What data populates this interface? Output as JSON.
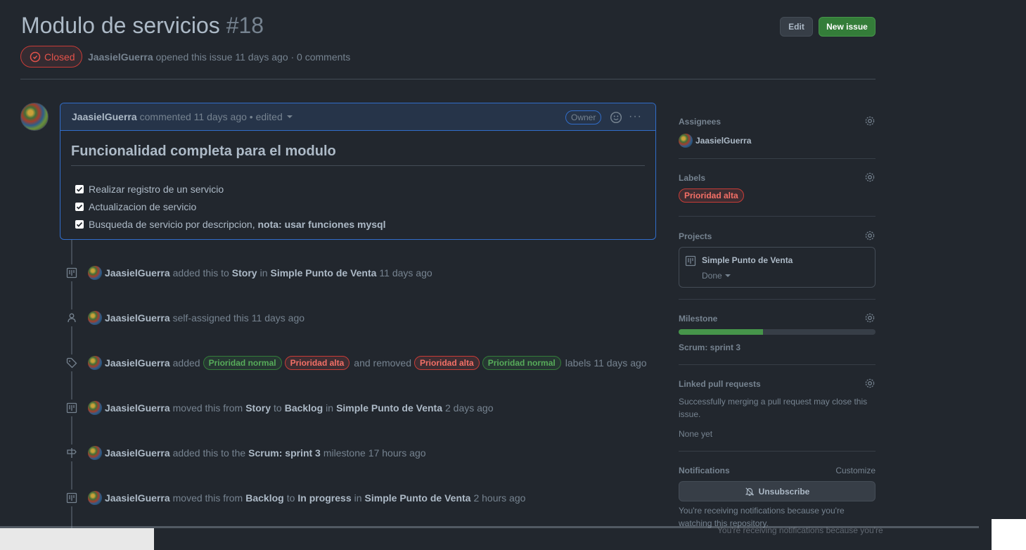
{
  "issue": {
    "title": "Modulo de servicios",
    "number": "#18",
    "state": "Closed",
    "author": "JaasielGuerra",
    "meta_text": "opened this issue 11 days ago · 0 comments",
    "edit_label": "Edit",
    "new_issue_label": "New issue"
  },
  "comment": {
    "author": "JaasielGuerra",
    "meta": "commented 11 days ago • edited",
    "badge": "Owner",
    "heading": "Funcionalidad completa para el modulo",
    "tasks": [
      {
        "text": "Realizar registro de un servicio",
        "strong": ""
      },
      {
        "text": "Actualizacion de servicio",
        "strong": ""
      },
      {
        "text": "Busqueda de servicio por descripcion, ",
        "strong": "nota: usar funciones mysql"
      }
    ]
  },
  "timeline": {
    "e1": {
      "user": "JaasielGuerra",
      "t1": "added this to",
      "column": "Story",
      "t2": "in",
      "project": "Simple Punto de Venta",
      "time": "11 days ago"
    },
    "e2": {
      "user": "JaasielGuerra",
      "t1": "self-assigned this",
      "time": "11 days ago"
    },
    "e3": {
      "user": "JaasielGuerra",
      "t1": "added",
      "label_a": "Prioridad normal",
      "label_b": "Prioridad alta",
      "t2": "and removed",
      "label_c": "Prioridad alta",
      "label_d": "Prioridad normal",
      "t3": "labels",
      "time": "11 days ago"
    },
    "e4": {
      "user": "JaasielGuerra",
      "t1": "moved this from",
      "from": "Story",
      "t2": "to",
      "to": "Backlog",
      "t3": "in",
      "project": "Simple Punto de Venta",
      "time": "2 days ago"
    },
    "e5": {
      "user": "JaasielGuerra",
      "t1": "added this to the",
      "milestone": "Scrum: sprint 3",
      "t2": "milestone",
      "time": "17 hours ago"
    },
    "e6": {
      "user": "JaasielGuerra",
      "t1": "moved this from",
      "from": "Backlog",
      "t2": "to",
      "to": "In progress",
      "t3": "in",
      "project": "Simple Punto de Venta",
      "time": "2 hours ago"
    }
  },
  "sidebar": {
    "assignees_title": "Assignees",
    "assignee": "JaasielGuerra",
    "labels_title": "Labels",
    "label": "Prioridad alta",
    "projects_title": "Projects",
    "project_name": "Simple Punto de Venta",
    "project_status": "Done",
    "milestone_title": "Milestone",
    "milestone_progress": 0.43,
    "milestone_name": "Scrum: sprint 3",
    "linked_title": "Linked pull requests",
    "linked_desc": "Successfully merging a pull request may close this issue.",
    "linked_none": "None yet",
    "notifications_title": "Notifications",
    "customize": "Customize",
    "unsubscribe": "Unsubscribe",
    "notif_desc": "You're receiving notifications because you're watching this repository.",
    "ghost_text": "You're receiving notifications because you're"
  },
  "colors": {
    "accent": "#316dca",
    "closed": "#e5534b",
    "green": "#46954a",
    "background": "#22272e"
  }
}
